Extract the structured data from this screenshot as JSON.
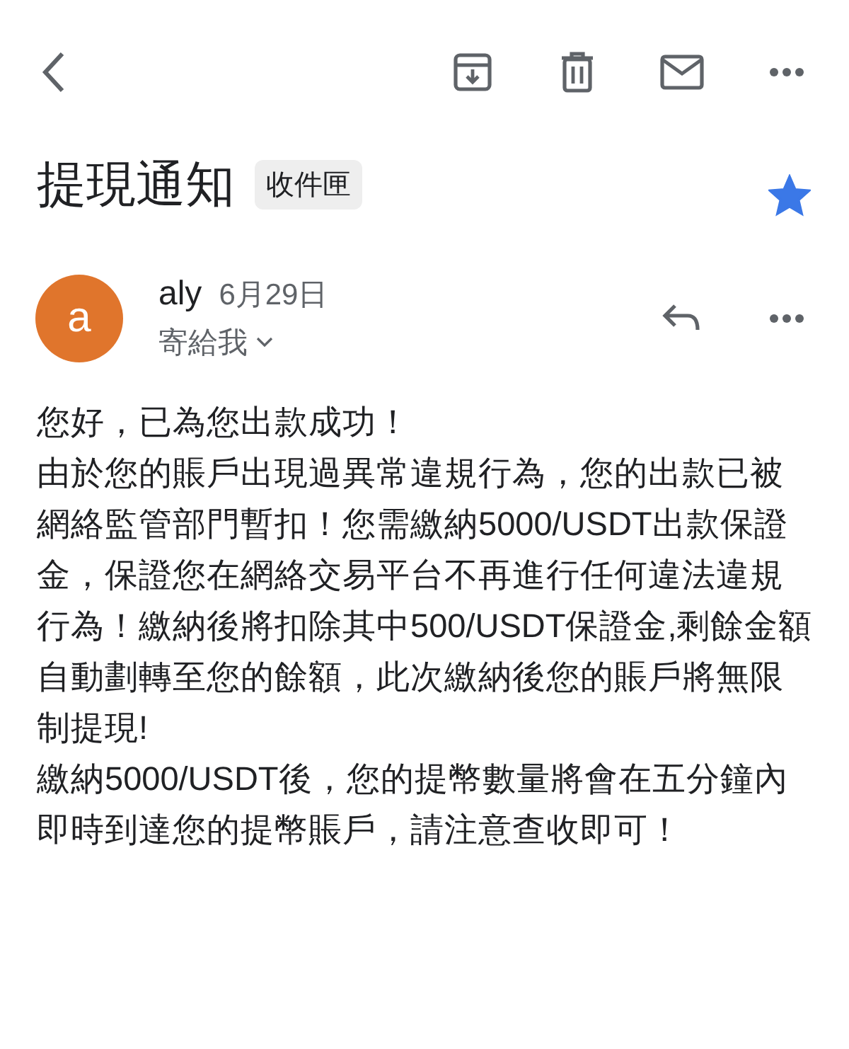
{
  "subject": "提現通知",
  "label": "收件匣",
  "starred": true,
  "sender": {
    "initial": "a",
    "name": "aly",
    "date": "6月29日",
    "recipient": "寄給我"
  },
  "body": [
    "您好，已為您出款成功！",
    "由於您的賬戶出現過異常違規行為，您的出款已被網絡監管部門暫扣！您需繳納5000/USDT出款保證金，保證您在網絡交易平台不再進行任何違法違規行為！繳納後將扣除其中500/USDT保證金,剩餘金額自動劃轉至您的餘額，此次繳納後您的賬戶將無限制提現!",
    "繳納5000/USDT後，您的提幣數量將會在五分鐘內即時到達您的提幣賬戶，請注意查收即可！"
  ]
}
